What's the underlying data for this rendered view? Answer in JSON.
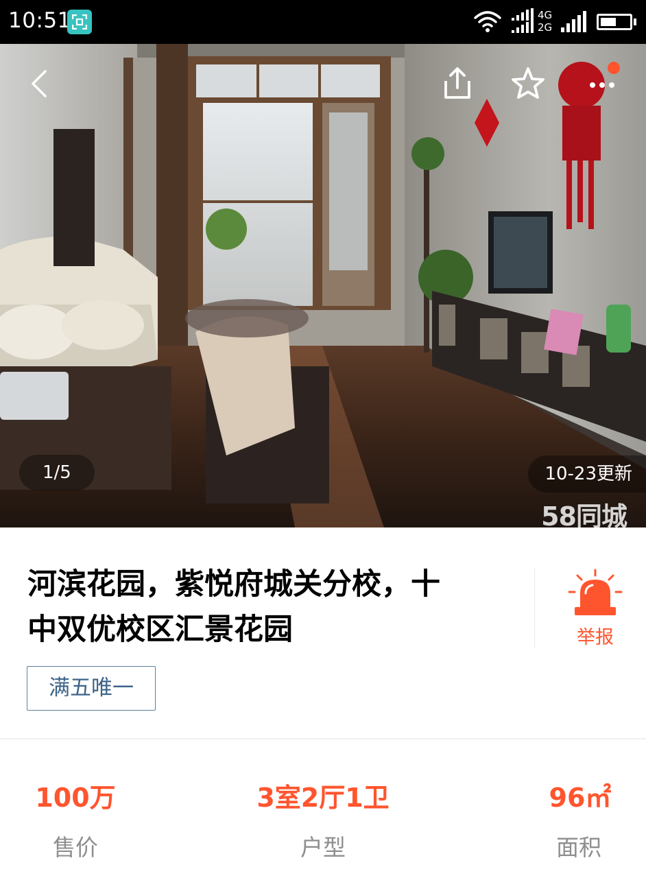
{
  "status_bar": {
    "time": "10:51",
    "network_top": "4G",
    "network_bottom": "2G",
    "battery_level": 0.55,
    "icons": [
      "screenshot-scan-icon",
      "wifi-icon",
      "signal-4g-icon",
      "signal-2g-icon",
      "battery-icon"
    ]
  },
  "header": {
    "icons": [
      "back-arrow-icon",
      "share-icon",
      "star-outline-icon",
      "more-dots-icon"
    ],
    "has_notification_dot": true
  },
  "gallery": {
    "counter": "1/5",
    "updated": "10-23更新",
    "watermark": "58同城"
  },
  "listing": {
    "title": "河滨花园，紫悦府城关分校，十中双优校区汇景花园",
    "report_label": "举报",
    "tags": [
      "满五唯一"
    ]
  },
  "stats": [
    {
      "value": "100万",
      "label": "售价"
    },
    {
      "value": "3室2厅1卫",
      "label": "户型"
    },
    {
      "value": "96㎡",
      "label": "面积"
    }
  ],
  "colors": {
    "accent": "#ff552e",
    "tag_border": "#5c7f9e",
    "tag_text": "#3d6488",
    "muted_text": "#8e8e8e",
    "status_bar_bg": "#000000",
    "scan_icon_bg": "#37c3c0"
  }
}
